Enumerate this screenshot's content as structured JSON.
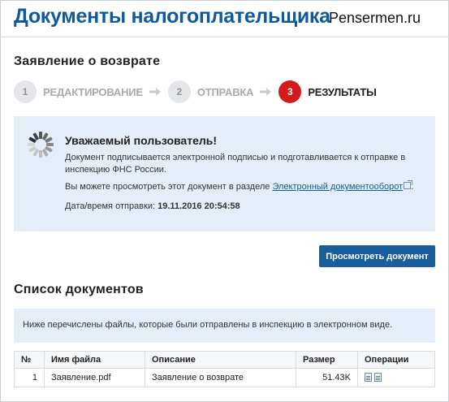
{
  "header": {
    "page_title": "Документы налогоплательщика",
    "watermark": "Pensermen.ru"
  },
  "section": {
    "title": "Заявление о возврате"
  },
  "steps": [
    {
      "number": "1",
      "label": "Редактирование",
      "state": "inactive"
    },
    {
      "number": "2",
      "label": "Отправка",
      "state": "inactive"
    },
    {
      "number": "3",
      "label": "Результаты",
      "state": "active"
    }
  ],
  "notice": {
    "title": "Уважаемый пользователь!",
    "line1": "Документ подписывается электронной подписью и подготавливается к отправке в",
    "line2": "инспекцию ФНС России.",
    "view_prefix": "Вы можете просмотреть этот документ в разделе ",
    "view_link": "Электронный документооборот",
    "view_suffix": ".",
    "sent_label": "Дата/время отправки: ",
    "sent_value": "19.11.2016 20:54:58"
  },
  "buttons": {
    "view_document": "Просмотреть документ"
  },
  "documents": {
    "title": "Список документов",
    "note": "Ниже перечислены файлы, которые были отправлены в инспекцию в электронном виде.",
    "columns": {
      "num": "№",
      "filename": "Имя файла",
      "description": "Описание",
      "size": "Размер",
      "operations": "Операции"
    },
    "rows": [
      {
        "num": "1",
        "filename": "Заявление.pdf",
        "description": "Заявление о возврате",
        "size": "51.43K"
      }
    ]
  },
  "colors": {
    "title_blue": "#0f5a9c",
    "active_step_red": "#d41b1b",
    "button_blue": "#1a5d9d",
    "panel_bg": "#e5eef8"
  },
  "icons": {
    "spinner": "loading-spinner-icon",
    "external": "external-link-icon",
    "view_op": "view-document-icon",
    "download_op": "download-document-icon",
    "step_arrow": "arrow-right-icon"
  }
}
